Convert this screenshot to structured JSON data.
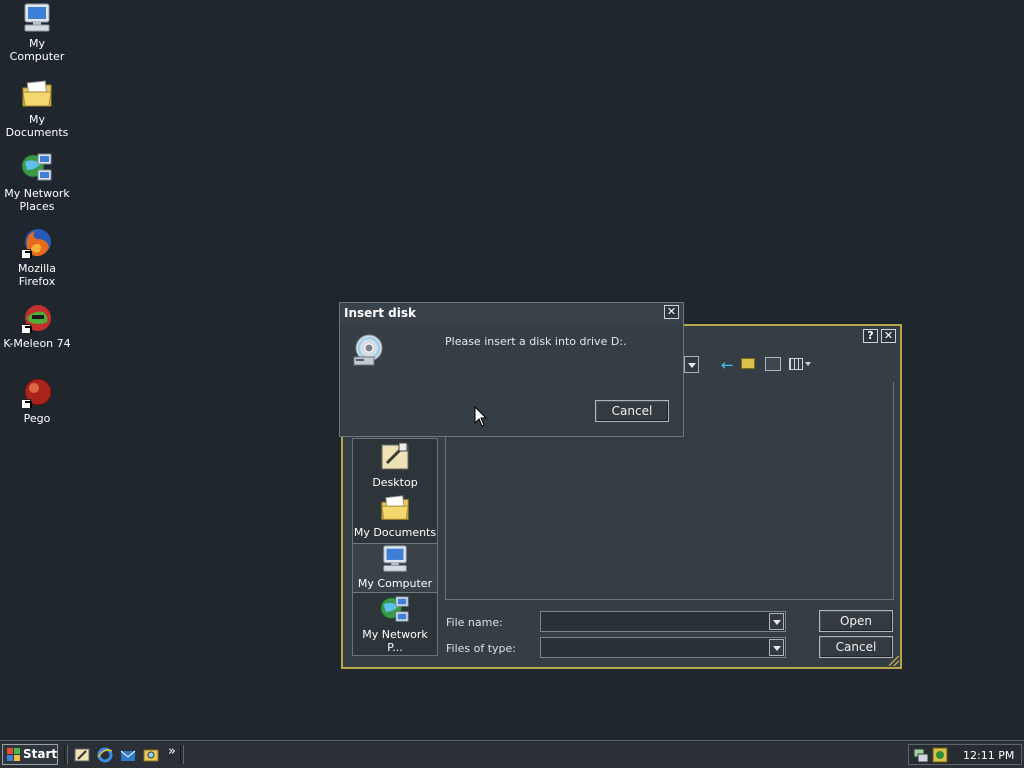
{
  "desktop": {
    "icons": [
      {
        "label": "My Computer"
      },
      {
        "label": "My Documents"
      },
      {
        "label": "My Network Places"
      },
      {
        "label": "Mozilla Firefox"
      },
      {
        "label": "K-Meleon 74"
      },
      {
        "label": "Pego"
      }
    ]
  },
  "open_dialog": {
    "help_label": "?",
    "close_label": "✕",
    "places": [
      {
        "label": "Desktop"
      },
      {
        "label": "My Documents"
      },
      {
        "label": "My Computer"
      },
      {
        "label": "My Network P..."
      }
    ],
    "file_name_label": "File name:",
    "file_name_value": "",
    "files_of_type_label": "Files of type:",
    "files_of_type_value": "",
    "open_button": "Open",
    "cancel_button": "Cancel"
  },
  "insert_disk": {
    "title": "Insert disk",
    "close_label": "✕",
    "message": "Please insert a disk into drive D:.",
    "cancel_button": "Cancel"
  },
  "taskbar": {
    "start_label": "Start",
    "overflow_label": "»",
    "clock": "12:11 PM"
  },
  "colors": {
    "desktop_bg": "#1f262d",
    "window_bg": "#363e45",
    "dialog_frame_accent": "#b9a64a"
  }
}
